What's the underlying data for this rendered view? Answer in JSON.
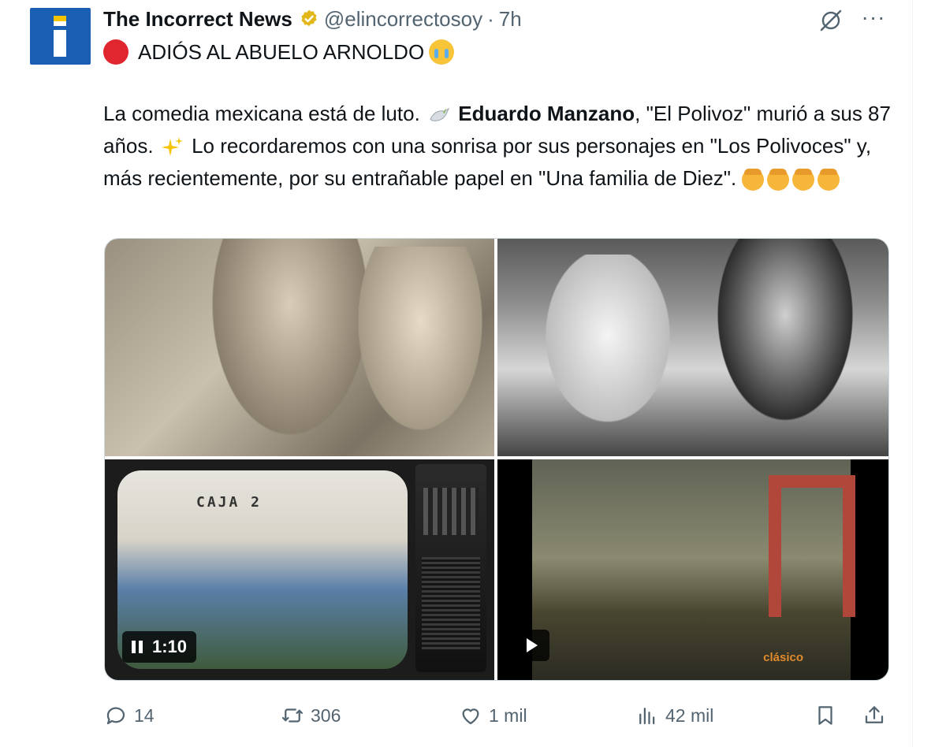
{
  "author": {
    "name": "The Incorrect News",
    "handle": "@elincorrectosoy",
    "separator": "·",
    "time": "7h",
    "avatar_icon": "info-i-logo-icon",
    "verified_icon": "verified-badge-icon"
  },
  "tweet": {
    "headline": "ADIÓS AL ABUELO ARNOLDO",
    "body_part1": "La comedia mexicana está de luto.",
    "body_bold": "Eduardo Manzano",
    "body_part2": ", \"El Polivoz\" murió a sus 87 años.",
    "body_part3": "Lo recordaremos con una sonrisa por sus personajes en \"Los Polivoces\" y, más recientemente, por su entrañable papel en \"Una familia de Diez\"."
  },
  "media": {
    "video_duration": "1:10",
    "tv_sign": "CAJA 2",
    "watermark": "clásico"
  },
  "actions": {
    "replies": "14",
    "reposts": "306",
    "likes": "1 mil",
    "views": "42 mil"
  },
  "colors": {
    "text": "#0f1419",
    "muted": "#536471",
    "accent_gold": "#f5b63a",
    "red_dot": "#e0262f"
  }
}
